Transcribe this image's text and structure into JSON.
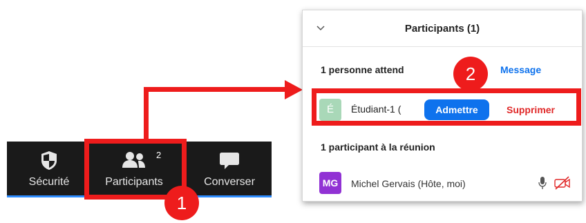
{
  "toolbar": {
    "items": [
      {
        "label": "Sécurité",
        "icon": "shield-icon"
      },
      {
        "label": "Participants",
        "icon": "people-icon",
        "badge": "2"
      },
      {
        "label": "Converser",
        "icon": "chat-bubble-icon"
      }
    ]
  },
  "callouts": {
    "step1": "1",
    "step2": "2"
  },
  "panel": {
    "title": "Participants (1)",
    "waiting_section": {
      "heading": "1 personne attend",
      "message_label": "Message",
      "entry": {
        "initial": "É",
        "name": "Étudiant-1 (",
        "admit_label": "Admettre",
        "remove_label": "Supprimer"
      }
    },
    "meeting_section": {
      "heading": "1 participant à la réunion",
      "entry": {
        "initials": "MG",
        "name": "Michel Gervais (Hôte, moi)"
      }
    }
  },
  "colors": {
    "highlight": "#ee1c1c",
    "accent_blue": "#0e72ed",
    "toolbar_bg": "#1a1a1a",
    "avatar_mg": "#9132d4",
    "avatar_e": "#a9d8b8"
  }
}
